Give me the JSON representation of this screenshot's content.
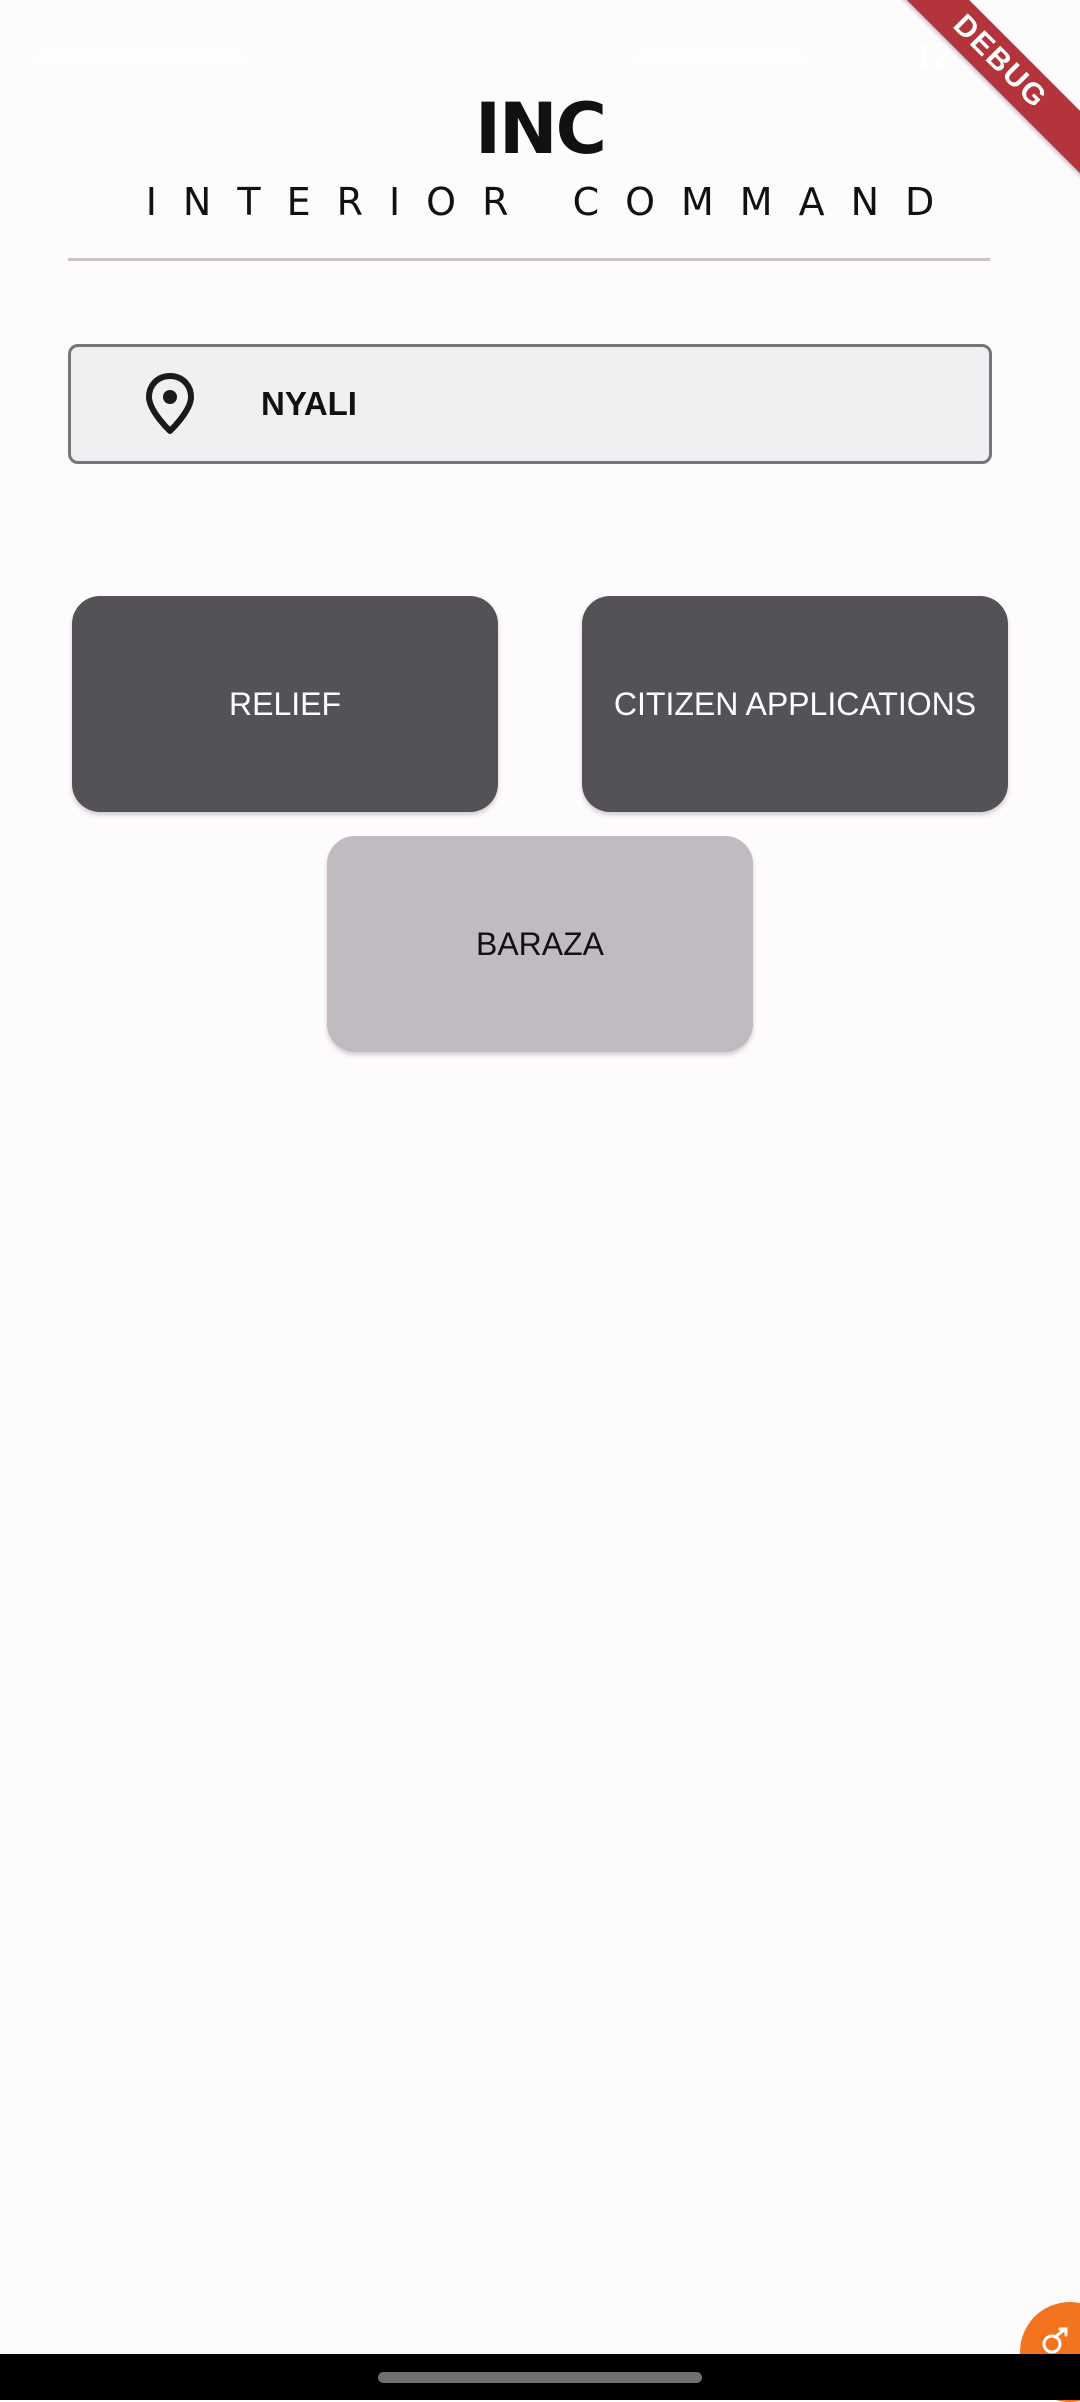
{
  "status_bar": {
    "time": "12:1"
  },
  "debug_banner": {
    "label": "DEBUG",
    "color": "#b3353b"
  },
  "header": {
    "logo": "INC",
    "subtitle": "INTERIOR COMMAND"
  },
  "location": {
    "icon": "location-pin-icon",
    "value": "NYALI"
  },
  "tiles": [
    {
      "label": "RELIEF",
      "style": "dark"
    },
    {
      "label": "CITIZEN APPLICATIONS",
      "style": "dark"
    },
    {
      "label": "BARAZA",
      "style": "light"
    }
  ],
  "colors": {
    "background": "#fefbfd",
    "tile_dark": "#545256",
    "tile_light": "#bfbbc0",
    "fab": "#f3731f"
  },
  "fab": {
    "icon": "link-icon"
  }
}
